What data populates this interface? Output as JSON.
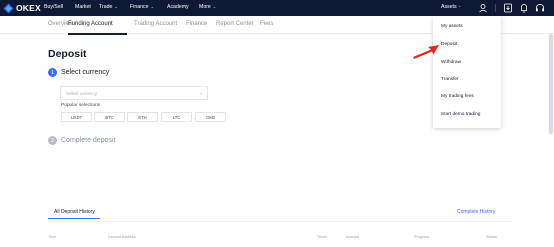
{
  "topnav": {
    "logo_text": "OKEX",
    "items": [
      {
        "label": "Buy/Sell",
        "has_caret": false
      },
      {
        "label": "Market",
        "has_caret": false
      },
      {
        "label": "Trade",
        "has_caret": true
      },
      {
        "label": "Finance",
        "has_caret": true
      },
      {
        "label": "Academy",
        "has_caret": false
      },
      {
        "label": "More",
        "has_caret": true
      }
    ],
    "assets_label": "Assets",
    "assets_caret": "^"
  },
  "subnav": {
    "tabs": [
      {
        "label": "Overview"
      },
      {
        "label": "Funding Account"
      },
      {
        "label": "Trading Account"
      },
      {
        "label": "Finance"
      },
      {
        "label": "Report Center"
      },
      {
        "label": "Fees"
      }
    ],
    "active_tab": "Funding Account"
  },
  "page": {
    "title": "Deposit",
    "step1": {
      "number": "1",
      "label": "Select currency"
    },
    "select_placeholder": "Select currency",
    "popular_label": "Popular selections",
    "popular": [
      "USDT",
      "BTC",
      "ETH",
      "LTC",
      "OKB"
    ],
    "step2": {
      "number": "2",
      "label": "Complete deposit"
    }
  },
  "dropdown": {
    "items": [
      "My assets",
      "Deposit",
      "Withdraw",
      "Transfer",
      "My trading fees",
      "Start demo trading"
    ]
  },
  "history": {
    "tab_label": "All Deposit History",
    "link_label": "Complete History",
    "columns": [
      "Time",
      "Deposit Address",
      "Token",
      "Amount",
      "Progress",
      "Status"
    ]
  },
  "icons": {
    "logo": "okex-logo-icon",
    "user": "user-icon",
    "download": "download-icon",
    "notification": "bell-icon",
    "support": "headset-icon"
  },
  "colors": {
    "nav_bg": "#0e1a35",
    "accent_blue": "#3d6ef5",
    "step_inactive": "#b6bcc7",
    "arrow_red": "#e5291c"
  }
}
